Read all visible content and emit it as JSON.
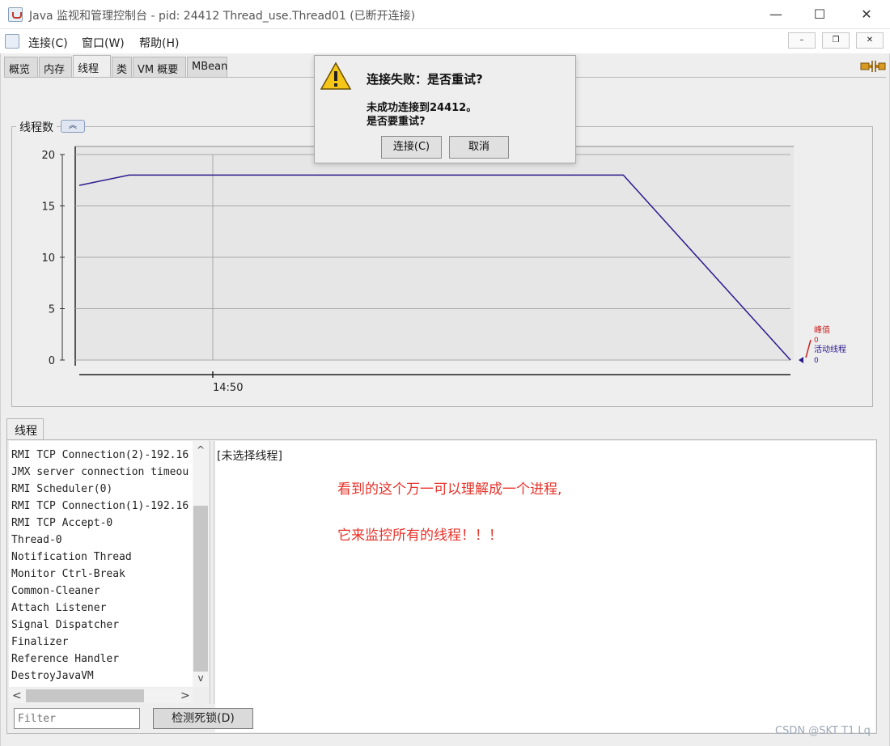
{
  "window": {
    "title": "Java 监视和管理控制台 - pid: 24412 Thread_use.Thread01 (已断开连接)",
    "minimize": "—",
    "maximize": "☐",
    "close": "✕"
  },
  "menubar": {
    "items": [
      "连接(C)",
      "窗口(W)",
      "帮助(H)"
    ],
    "mdi_minimize": "–",
    "mdi_restore": "❐",
    "mdi_close": "✕"
  },
  "tabs": [
    "概览",
    "内存",
    "线程",
    "类",
    "VM 概要",
    "MBean"
  ],
  "active_tab": "线程",
  "chart_panel": {
    "label": "线程数",
    "collapse_icon": "chevron-up-icon"
  },
  "chart_data": {
    "type": "line",
    "title": "线程数",
    "xlabel": "",
    "ylabel": "",
    "ylim": [
      0,
      20
    ],
    "yticks": [
      "0",
      "5",
      "10",
      "15",
      "20"
    ],
    "xticks": [
      "14:50"
    ],
    "series": [
      {
        "name": "活动线程",
        "color": "#2a1a8c",
        "points": [
          [
            0,
            17
          ],
          [
            0.07,
            18
          ],
          [
            0.765,
            18
          ],
          [
            1.0,
            0
          ]
        ]
      }
    ],
    "legend": [
      {
        "name": "峰值",
        "value": "0",
        "color": "#cc2222"
      },
      {
        "name": "活动线程",
        "value": "0",
        "color": "#2a1a8c"
      }
    ],
    "grid": true,
    "legend_position": "right"
  },
  "threads_section": {
    "tab_label": "线程",
    "list": [
      "RMI TCP Connection(2)-192.16",
      "JMX server connection timeou",
      "RMI Scheduler(0)",
      "RMI TCP Connection(1)-192.16",
      "RMI TCP Accept-0",
      "Thread-0",
      "Notification Thread",
      "Monitor Ctrl-Break",
      "Common-Cleaner",
      "Attach Listener",
      "Signal Dispatcher",
      "Finalizer",
      "Reference Handler",
      "DestroyJavaVM"
    ],
    "detail_title": "[未选择线程]",
    "filter_placeholder": "Filter",
    "detect_button": "检测死锁(D)",
    "annotation_line1": "看到的这个万一可以理解成一个进程,",
    "annotation_line2": "它来监控所有的线程！！！"
  },
  "dialog": {
    "title": "连接失败：是否重试?",
    "message_line1": "未成功连接到24412。",
    "message_line2": "是否要重试?",
    "connect_button": "连接(C)",
    "cancel_button": "取消"
  },
  "watermark": "CSDN @SKT T1 Lq",
  "colors": {
    "series_line": "#2a1a8c",
    "peak": "#cc2222",
    "annotation": "#e8322a"
  }
}
